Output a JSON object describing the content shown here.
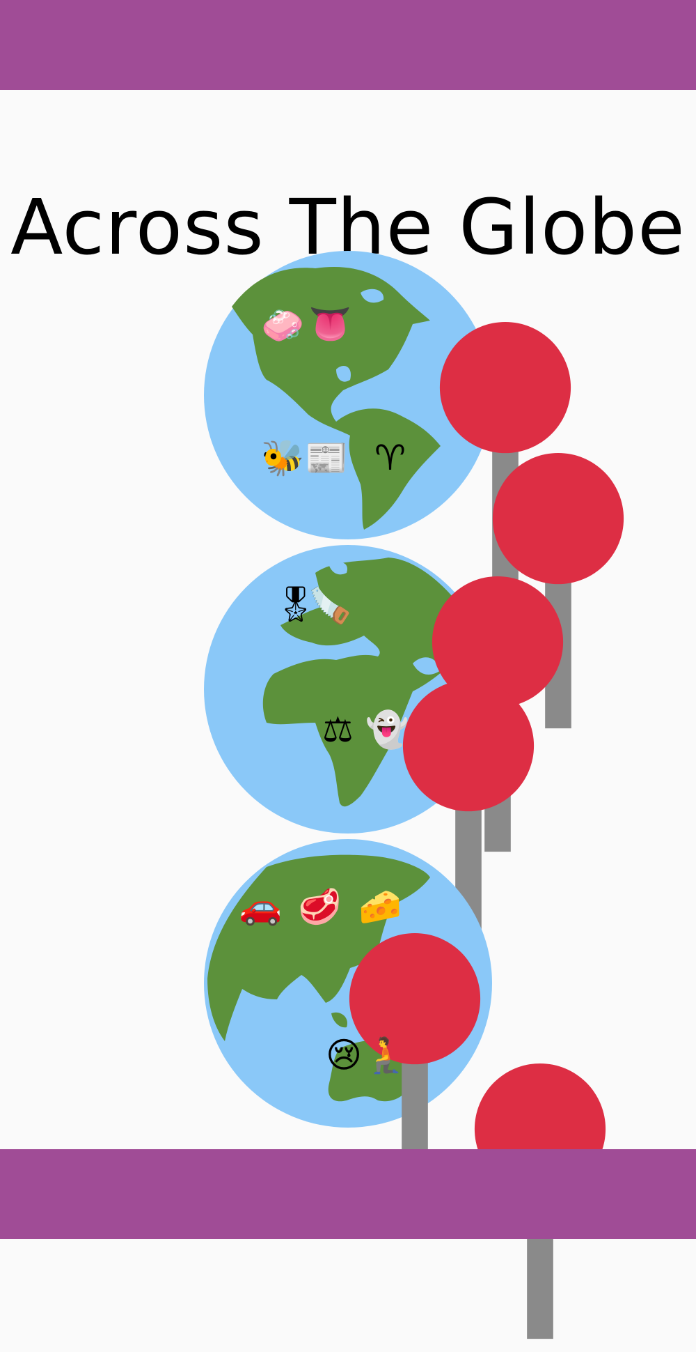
{
  "title": "Across The Globe",
  "colors": {
    "band": "#a04c96",
    "ocean": "#8ac8f8",
    "land": "#5c913b",
    "pin": "#dd2e44",
    "background": "#fafafa"
  },
  "globes": [
    {
      "region": "americas",
      "clues": [
        {
          "row": 1,
          "icons": [
            "soap-icon",
            "tongue-icon"
          ],
          "glyphs": [
            "🧼",
            "👅"
          ]
        },
        {
          "row": 2,
          "icons": [
            "bee-icon",
            "newspaper-icon",
            "aries-icon"
          ],
          "glyphs": [
            "🐝",
            "📰",
            "♈"
          ]
        }
      ]
    },
    {
      "region": "europe-africa",
      "clues": [
        {
          "row": 1,
          "icons": [
            "military-medal-icon",
            "saw-icon"
          ],
          "glyphs": [
            "🎖",
            "🪚"
          ]
        },
        {
          "row": 2,
          "icons": [
            "scales-icon",
            "ghost-icon"
          ],
          "glyphs": [
            "⚖",
            "👻"
          ]
        }
      ]
    },
    {
      "region": "asia-australia",
      "clues": [
        {
          "row": 1,
          "icons": [
            "car-icon",
            "steak-icon",
            "cheese-icon"
          ],
          "glyphs": [
            "🚗",
            "🥩",
            "🧀"
          ]
        },
        {
          "row": 2,
          "icons": [
            "crying-face-icon",
            "kneeling-person-icon"
          ],
          "glyphs": [
            "😢",
            "🧎"
          ]
        }
      ]
    }
  ]
}
